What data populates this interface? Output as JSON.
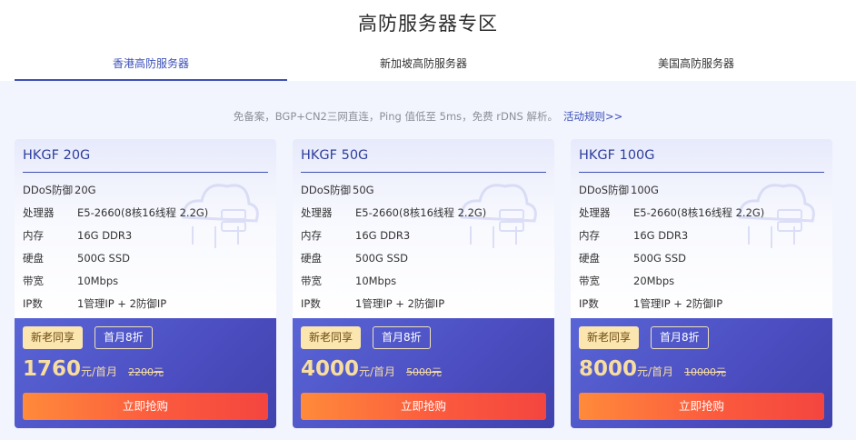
{
  "page": {
    "title": "高防服务器专区"
  },
  "tabs": [
    {
      "label": "香港高防服务器",
      "active": true
    },
    {
      "label": "新加坡高防服务器",
      "active": false
    },
    {
      "label": "美国高防服务器",
      "active": false
    }
  ],
  "notice": {
    "text": "免备案，BGP+CN2三网直连，Ping 值低至 5ms，免费 rDNS 解析。",
    "link": "活动规则>>"
  },
  "colors": {
    "accent": "#3f51b5",
    "price": "#f7dea0",
    "buy_button": "#f4453f",
    "card_bottom": "#4b4dc0"
  },
  "cards": [
    {
      "name": "HKGF 20G",
      "ddos_label": "DDoS防御",
      "ddos_value": "20G",
      "cpu_label": "处理器",
      "cpu_value": "E5-2660(8核16线程 2.2G)",
      "ram_label": "内存",
      "ram_value": "16G DDR3",
      "disk_label": "硬盘",
      "disk_value": "500G SSD",
      "bw_label": "带宽",
      "bw_value": "10Mbps",
      "ip_label": "IP数",
      "ip_value": "1管理IP + 2防御IP",
      "badge_new": "新老同享",
      "badge_discount": "首月8折",
      "price": "1760",
      "price_unit": "元/首月",
      "price_old": "2200元",
      "buy_label": "立即抢购"
    },
    {
      "name": "HKGF 50G",
      "ddos_label": "DDoS防御",
      "ddos_value": "50G",
      "cpu_label": "处理器",
      "cpu_value": "E5-2660(8核16线程 2.2G)",
      "ram_label": "内存",
      "ram_value": "16G DDR3",
      "disk_label": "硬盘",
      "disk_value": "500G SSD",
      "bw_label": "带宽",
      "bw_value": "10Mbps",
      "ip_label": "IP数",
      "ip_value": "1管理IP + 2防御IP",
      "badge_new": "新老同享",
      "badge_discount": "首月8折",
      "price": "4000",
      "price_unit": "元/首月",
      "price_old": "5000元",
      "buy_label": "立即抢购"
    },
    {
      "name": "HKGF 100G",
      "ddos_label": "DDoS防御",
      "ddos_value": "100G",
      "cpu_label": "处理器",
      "cpu_value": "E5-2660(8核16线程 2.2G)",
      "ram_label": "内存",
      "ram_value": "16G DDR3",
      "disk_label": "硬盘",
      "disk_value": "500G SSD",
      "bw_label": "带宽",
      "bw_value": "20Mbps",
      "ip_label": "IP数",
      "ip_value": "1管理IP + 2防御IP",
      "badge_new": "新老同享",
      "badge_discount": "首月8折",
      "price": "8000",
      "price_unit": "元/首月",
      "price_old": "10000元",
      "buy_label": "立即抢购"
    }
  ]
}
